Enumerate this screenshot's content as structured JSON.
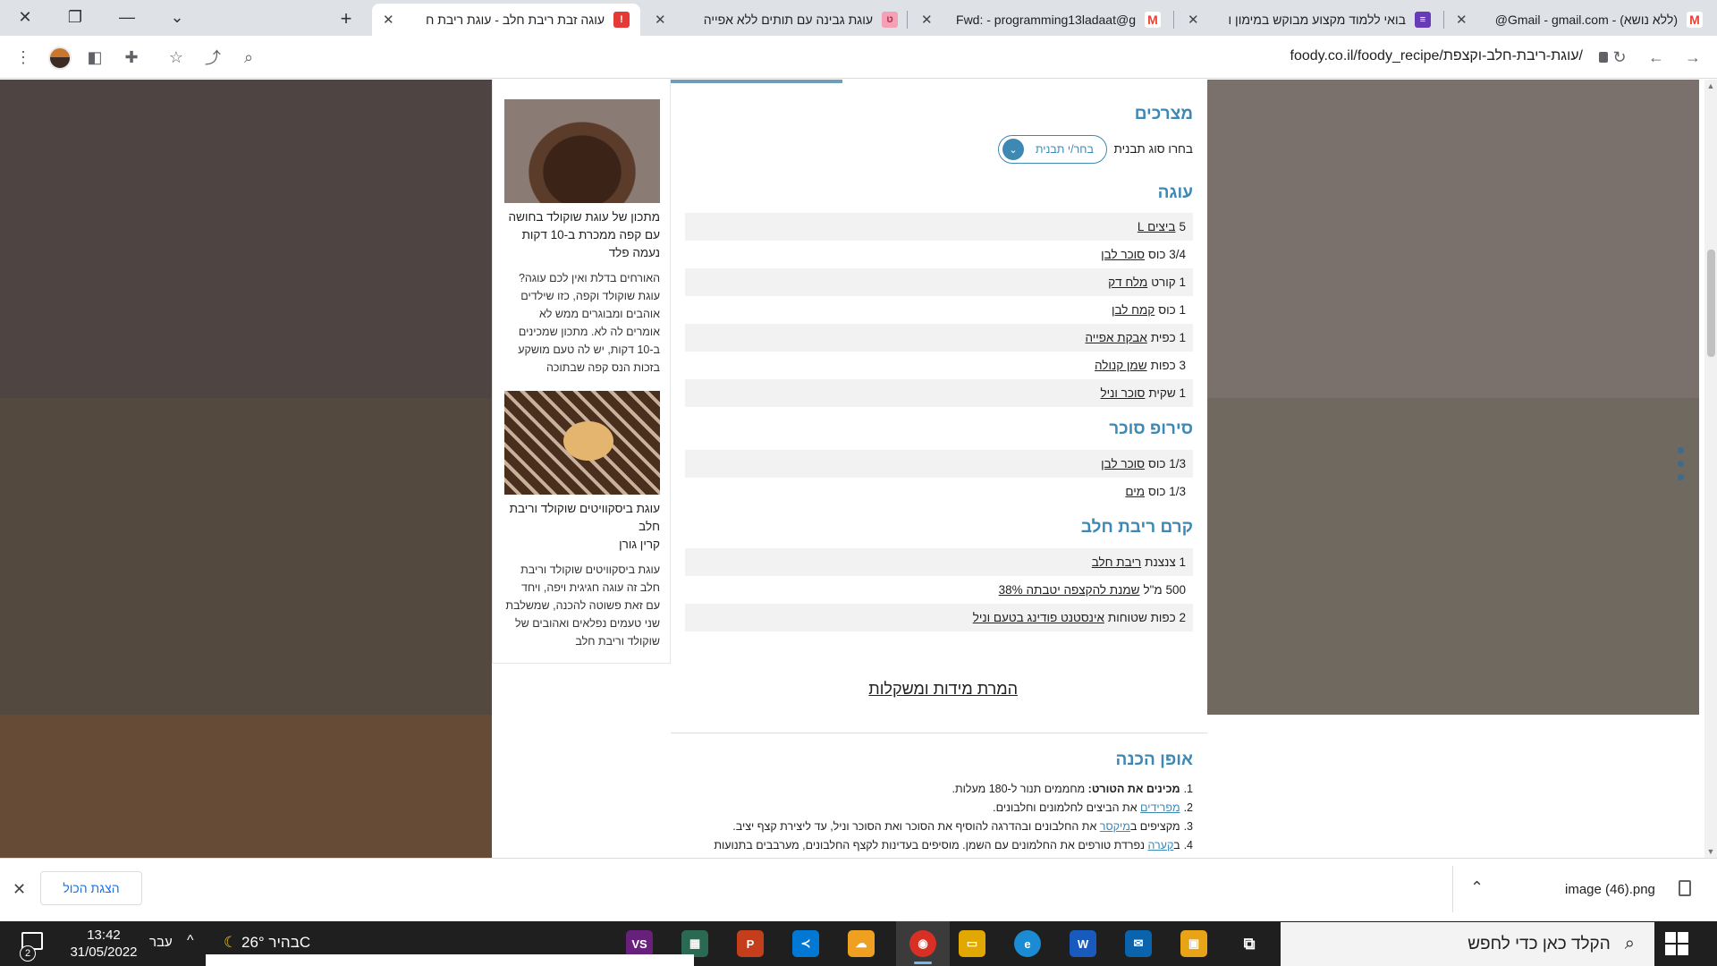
{
  "browser": {
    "tabs": [
      {
        "title": "(ללא נושא) - Gmail - gmail.com@",
        "favicon": "gmail-icon",
        "active": false
      },
      {
        "title": "בואי ללמוד מקצוע מבוקש במימון ו",
        "favicon": "forms-icon",
        "active": false
      },
      {
        "title": "Fwd: - programming13ladaat@g",
        "favicon": "gmail-icon",
        "active": false
      },
      {
        "title": "עוגת גבינה עם תותים ללא אפייה",
        "favicon": "recipe-icon",
        "active": false
      },
      {
        "title": "עוגה זבת ריבת חלב - עוגת ריבת ח",
        "favicon": "foody-icon",
        "active": true
      }
    ],
    "url": "foody.co.il/foody_recipe/עוגת-ריבת-חלב-וקצפת/",
    "accent": "#1a73e8"
  },
  "sidebar": {
    "cards": [
      {
        "title": "מתכון של עוגת שוקולד בחושה עם קפה ממכרת ב-10 דקות",
        "author": "נעמה פלד",
        "desc": "האורחים בדלת ואין לכם עוגה? עוגת שוקולד וקפה, כזו שילדים אוהבים ומבוגרים ממש לא אומרים לה לא. מתכון שמכינים ב-10 דקות, יש לה טעם מושקע בזכות הנס קפה שבתוכה"
      },
      {
        "title": "עוגת ביסקוויטים שוקולד וריבת חלב",
        "author": "קרין גורן",
        "desc": "עוגת ביסקוויטים שוקולד וריבת חלב זה עוגה חגיגית ויפה, ויחד עם זאת פשוטה להכנה, שמשלבת שני טעמים נפלאים ואהובים של שוקולד וריבת חלב"
      }
    ]
  },
  "recipe": {
    "ingredients_title": "מצרכים",
    "mold_label": "בחרו סוג תבנית",
    "mold_select": "בחר/י תבנית",
    "sections": [
      {
        "title": "עוגה",
        "items": [
          {
            "amount": "5",
            "name": "ביצים L"
          },
          {
            "amount": "3/4 כוס",
            "name": "סוכר לבן"
          },
          {
            "amount": "1 קורט",
            "name": "מלח דק"
          },
          {
            "amount": "1 כוס",
            "name": "קמח לבן"
          },
          {
            "amount": "1 כפית",
            "name": "אבקת אפייה"
          },
          {
            "amount": "3 כפות",
            "name": "שמן קנולה"
          },
          {
            "amount": "1 שקית",
            "name": "סוכר וניל"
          }
        ]
      },
      {
        "title": "סירופ סוכר",
        "items": [
          {
            "amount": "1/3 כוס",
            "name": "סוכר לבן"
          },
          {
            "amount": "1/3 כוס",
            "name": "מים"
          }
        ]
      },
      {
        "title": "קרם ריבת חלב",
        "items": [
          {
            "amount": "1 צנצנת",
            "name": "ריבת חלב"
          },
          {
            "amount": "500 מ\"ל",
            "name": "שמנת להקצפה יטבתה 38%"
          },
          {
            "amount": "2 כפות שטוחות",
            "name": "אינסטנט פודינג בטעם וניל"
          }
        ]
      }
    ],
    "convert_link": "המרת מידות ומשקלות",
    "prep_title": "אופן הכנה",
    "prep_steps": [
      {
        "num": "1.",
        "bold": "מכינים את הטורט:",
        "pre": "",
        "link": "",
        "text": " מחממים תנור ל-180 מעלות."
      },
      {
        "num": "2.",
        "bold": "",
        "pre": "",
        "link": "מפרידים",
        "text": " את הביצים לחלמונים וחלבונים."
      },
      {
        "num": "3.",
        "bold": "",
        "pre": "מקציפים ב",
        "link": "מיקסר",
        "text": " את החלבונים ובהדרגה להוסיף את הסוכר ואת הסוכר וניל, עד ליצירת קצף יציב."
      },
      {
        "num": "4.",
        "bold": "",
        "pre": "ב",
        "link": "קערה",
        "text": " נפרדת טורפים את החלמונים עם השמן. מוסיפים בעדינות לקצף החלבונים, מערבבים בתנועות"
      }
    ],
    "accent": "#3e88b4"
  },
  "downloads": {
    "show_all": "הצגת הכול",
    "file": "image (46).png"
  },
  "taskbar": {
    "search_placeholder": "הקלד כאן כדי לחפש",
    "time": "13:42",
    "date": "31/05/2022",
    "lang": "עבר",
    "weather": "בהיר  26°C",
    "notif_count": "2",
    "apps": [
      {
        "name": "visual-studio-icon",
        "color": "#68217a",
        "label": "VS"
      },
      {
        "name": "app-icon",
        "color": "#2a6a52",
        "label": "▦"
      },
      {
        "name": "powerpoint-icon",
        "color": "#c43e1c",
        "label": "P"
      },
      {
        "name": "vscode-icon",
        "color": "#0078d4",
        "label": "≺"
      },
      {
        "name": "weather-app-icon",
        "color": "#f0a020",
        "label": "☁"
      },
      {
        "name": "chrome-icon",
        "color": "#d93025",
        "label": "◉"
      },
      {
        "name": "file-explorer-icon",
        "color": "#e0a800",
        "label": "▭"
      },
      {
        "name": "edge-icon",
        "color": "#1b8bd4",
        "label": "e"
      },
      {
        "name": "word-icon",
        "color": "#185abd",
        "label": "W"
      },
      {
        "name": "mail-icon",
        "color": "#0a64ad",
        "label": "✉"
      },
      {
        "name": "store-icon",
        "color": "#e8a317",
        "label": "▣"
      },
      {
        "name": "task-view-icon",
        "color": "#1f1f1f",
        "label": "⧉"
      }
    ]
  }
}
